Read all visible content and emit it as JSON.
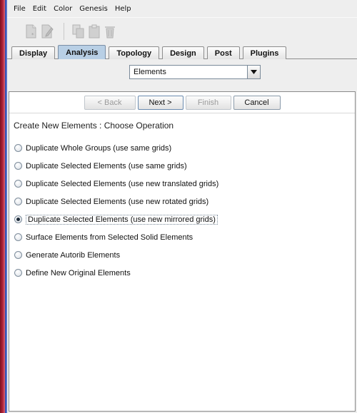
{
  "menubar": [
    "File",
    "Edit",
    "Color",
    "Genesis",
    "Help"
  ],
  "toolbar": {
    "icons": [
      "new-document-icon",
      "edit-document-icon",
      "copy-icon",
      "paste-icon",
      "delete-icon"
    ]
  },
  "tabs": [
    {
      "label": "Display",
      "active": false
    },
    {
      "label": "Analysis",
      "active": true
    },
    {
      "label": "Topology",
      "active": false
    },
    {
      "label": "Design",
      "active": false
    },
    {
      "label": "Post",
      "active": false
    },
    {
      "label": "Plugins",
      "active": false
    }
  ],
  "category_select": {
    "value": "Elements"
  },
  "wizard": {
    "back_label": "< Back",
    "next_label": "Next >",
    "finish_label": "Finish",
    "cancel_label": "Cancel",
    "heading": "Create New Elements : Choose Operation",
    "options": [
      {
        "label": "Duplicate Whole Groups (use same grids)",
        "checked": false
      },
      {
        "label": "Duplicate Selected Elements (use same grids)",
        "checked": false
      },
      {
        "label": "Duplicate Selected Elements (use new translated grids)",
        "checked": false
      },
      {
        "label": "Duplicate Selected Elements (use new rotated grids)",
        "checked": false
      },
      {
        "label": "Duplicate Selected Elements (use new mirrored grids)",
        "checked": true
      },
      {
        "label": "Surface Elements from Selected Solid Elements",
        "checked": false
      },
      {
        "label": "Generate Autorib Elements",
        "checked": false
      },
      {
        "label": "Define New Original Elements",
        "checked": false
      }
    ]
  },
  "colors": {
    "active_tab": "#b8cfe5",
    "window_stripe": "#b1233a"
  }
}
